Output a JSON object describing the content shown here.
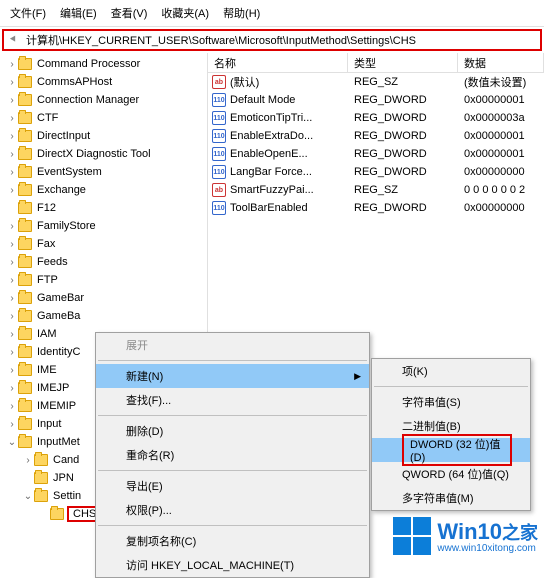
{
  "menu": {
    "file": "文件(F)",
    "edit": "编辑(E)",
    "view": "查看(V)",
    "fav": "收藏夹(A)",
    "help": "帮助(H)"
  },
  "address": {
    "path": "计算机\\HKEY_CURRENT_USER\\Software\\Microsoft\\InputMethod\\Settings\\CHS"
  },
  "columns": {
    "name": "名称",
    "type": "类型",
    "data": "数据"
  },
  "tree": [
    {
      "d": 1,
      "exp": ">",
      "label": "Command Processor"
    },
    {
      "d": 1,
      "exp": ">",
      "label": "CommsAPHost"
    },
    {
      "d": 1,
      "exp": ">",
      "label": "Connection Manager"
    },
    {
      "d": 1,
      "exp": ">",
      "label": "CTF"
    },
    {
      "d": 1,
      "exp": ">",
      "label": "DirectInput"
    },
    {
      "d": 1,
      "exp": ">",
      "label": "DirectX Diagnostic Tool"
    },
    {
      "d": 1,
      "exp": ">",
      "label": "EventSystem"
    },
    {
      "d": 1,
      "exp": ">",
      "label": "Exchange"
    },
    {
      "d": 1,
      "exp": "",
      "label": "F12"
    },
    {
      "d": 1,
      "exp": ">",
      "label": "FamilyStore"
    },
    {
      "d": 1,
      "exp": ">",
      "label": "Fax"
    },
    {
      "d": 1,
      "exp": ">",
      "label": "Feeds"
    },
    {
      "d": 1,
      "exp": ">",
      "label": "FTP"
    },
    {
      "d": 1,
      "exp": ">",
      "label": "GameBar"
    },
    {
      "d": 1,
      "exp": ">",
      "label": "GameBa"
    },
    {
      "d": 1,
      "exp": ">",
      "label": "IAM"
    },
    {
      "d": 1,
      "exp": ">",
      "label": "IdentityC"
    },
    {
      "d": 1,
      "exp": ">",
      "label": "IME"
    },
    {
      "d": 1,
      "exp": ">",
      "label": "IMEJP"
    },
    {
      "d": 1,
      "exp": ">",
      "label": "IMEMIP"
    },
    {
      "d": 1,
      "exp": ">",
      "label": "Input"
    },
    {
      "d": 1,
      "exp": "v",
      "label": "InputMet"
    },
    {
      "d": 2,
      "exp": ">",
      "label": "Cand"
    },
    {
      "d": 2,
      "exp": "",
      "label": "JPN"
    },
    {
      "d": 2,
      "exp": "v",
      "label": "Settin"
    },
    {
      "d": 3,
      "exp": "",
      "label": "CHS",
      "boxed": true
    }
  ],
  "values": [
    {
      "icon": "sz",
      "name": "(默认)",
      "type": "REG_SZ",
      "data": "(数值未设置)"
    },
    {
      "icon": "dw",
      "name": "Default Mode",
      "type": "REG_DWORD",
      "data": "0x00000001"
    },
    {
      "icon": "dw",
      "name": "EmoticonTipTri...",
      "type": "REG_DWORD",
      "data": "0x0000003a"
    },
    {
      "icon": "dw",
      "name": "EnableExtraDo...",
      "type": "REG_DWORD",
      "data": "0x00000001"
    },
    {
      "icon": "dw",
      "name": "EnableOpenE...",
      "type": "REG_DWORD",
      "data": "0x00000001"
    },
    {
      "icon": "dw",
      "name": "LangBar Force...",
      "type": "REG_DWORD",
      "data": "0x00000000"
    },
    {
      "icon": "sz",
      "name": "SmartFuzzyPai...",
      "type": "REG_SZ",
      "data": "0 0 0 0 0 0 2"
    },
    {
      "icon": "dw",
      "name": "ToolBarEnabled",
      "type": "REG_DWORD",
      "data": "0x00000000"
    }
  ],
  "ctx1": {
    "expand": "展开",
    "new": "新建(N)",
    "find": "查找(F)...",
    "delete": "删除(D)",
    "rename": "重命名(R)",
    "export": "导出(E)",
    "perm": "权限(P)...",
    "copykey": "复制项名称(C)",
    "gotohklm": "访问 HKEY_LOCAL_MACHINE(T)"
  },
  "ctx2": {
    "key": "项(K)",
    "string": "字符串值(S)",
    "binary": "二进制值(B)",
    "dword": "DWORD (32 位)值(D)",
    "qword": "QWORD (64 位)值(Q)",
    "multi": "多字符串值(M)"
  },
  "watermark": {
    "title": "Win10",
    "suffix": "之家",
    "url": "www.win10xitong.com"
  }
}
